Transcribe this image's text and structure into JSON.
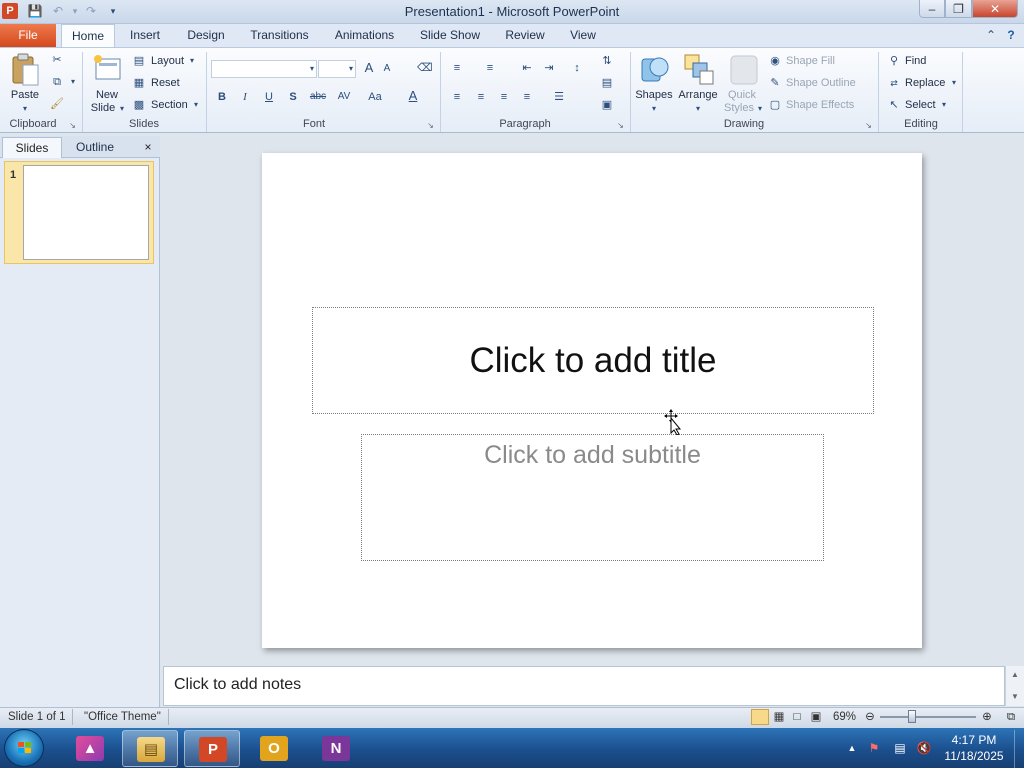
{
  "window": {
    "title": "Presentation1 - Microsoft PowerPoint",
    "app_icon": "P"
  },
  "quick_access": {
    "save": "save-icon",
    "undo": "undo-icon",
    "redo": "redo-icon",
    "customize": "customize-icon"
  },
  "tabs": {
    "file": "File",
    "items": [
      "Home",
      "Insert",
      "Design",
      "Transitions",
      "Animations",
      "Slide Show",
      "Review",
      "View"
    ],
    "active": "Home"
  },
  "ribbon": {
    "clipboard": {
      "group": "Clipboard",
      "paste": "Paste"
    },
    "slides": {
      "group": "Slides",
      "new_slide_1": "New",
      "new_slide_2": "Slide",
      "layout": "Layout",
      "reset": "Reset",
      "section": "Section"
    },
    "font": {
      "group": "Font",
      "bold": "B",
      "italic": "I",
      "underline": "U",
      "shadow": "S",
      "strike": "abc",
      "spacing": "AV",
      "case": "Aa",
      "color": "A",
      "grow": "A",
      "shrink": "A"
    },
    "paragraph": {
      "group": "Paragraph"
    },
    "drawing": {
      "group": "Drawing",
      "shapes": "Shapes",
      "arrange": "Arrange",
      "quick_styles_1": "Quick",
      "quick_styles_2": "Styles",
      "shape_fill": "Shape Fill",
      "shape_outline": "Shape Outline",
      "shape_effects": "Shape Effects"
    },
    "editing": {
      "group": "Editing",
      "find": "Find",
      "replace": "Replace",
      "select": "Select"
    }
  },
  "pane": {
    "tab_slides": "Slides",
    "tab_outline": "Outline",
    "close": "×",
    "slide_number": "1"
  },
  "slide": {
    "title_placeholder": "Click to add title",
    "subtitle_placeholder": "Click to add subtitle"
  },
  "notes": {
    "placeholder": "Click to add notes"
  },
  "status": {
    "slide_info": "Slide 1 of 1",
    "theme": "\"Office Theme\"",
    "zoom": "69%"
  },
  "taskbar": {
    "time": "4:17 PM",
    "date": "11/18/2025",
    "apps": [
      "generic-app",
      "file-explorer",
      "powerpoint",
      "outlook",
      "onenote"
    ]
  },
  "colors": {
    "file_tab": "#d4481d",
    "powerpoint": "#d24726",
    "outlook": "#e2a41c",
    "onenote": "#7b3699",
    "taskbar": "#1b4f8d"
  }
}
